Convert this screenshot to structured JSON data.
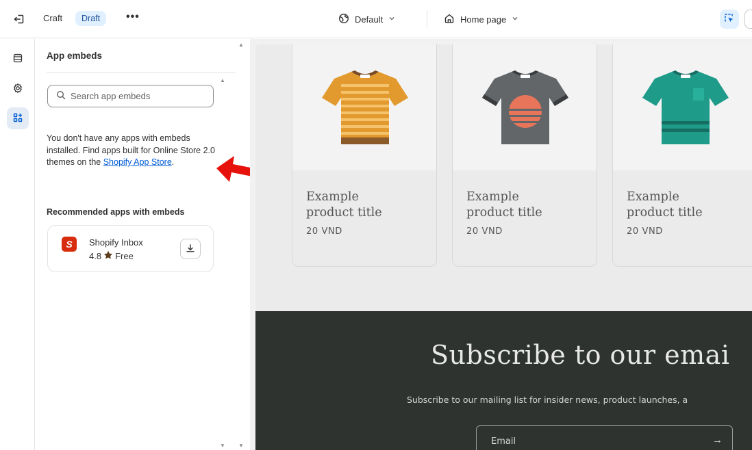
{
  "topbar": {
    "theme_name": "Craft",
    "status_badge": "Draft",
    "more_label": "•••",
    "context_label": "Default",
    "page_label": "Home page"
  },
  "panel": {
    "title": "App embeds",
    "search_placeholder": "Search app embeds",
    "empty_message_pre": "You don't have any apps with embeds installed. Find apps built for Online Store 2.0 themes on the ",
    "empty_message_link": "Shopify App Store",
    "empty_message_post": ".",
    "recommended_title": "Recommended apps with embeds",
    "app": {
      "name": "Shopify Inbox",
      "rating": "4.8",
      "price": "Free",
      "icon_letter": "S"
    }
  },
  "preview": {
    "products": [
      {
        "title_line1": "Example",
        "title_line2": "product title",
        "price": "20 VND",
        "shirt_color": "#e29a2e",
        "stripe_color": "#f5c36b"
      },
      {
        "title_line1": "Example",
        "title_line2": "product title",
        "price": "20 VND",
        "shirt_color": "#636669",
        "stripe_color": "#e8755a"
      },
      {
        "title_line1": "Example",
        "title_line2": "product title",
        "price": "20 VND",
        "shirt_color": "#1f9b8a",
        "stripe_color": "#146e62"
      }
    ],
    "newsletter": {
      "title": "Subscribe to our emai",
      "subtitle": "Subscribe to our mailing list for insider news, product launches, a",
      "email_placeholder": "Email",
      "submit_icon": "→"
    }
  },
  "colors": {
    "accent_blue": "#005bd3",
    "badge_bg": "#e0f0ff",
    "annotation_red": "#e8120c",
    "newsletter_bg": "#2e3330"
  }
}
